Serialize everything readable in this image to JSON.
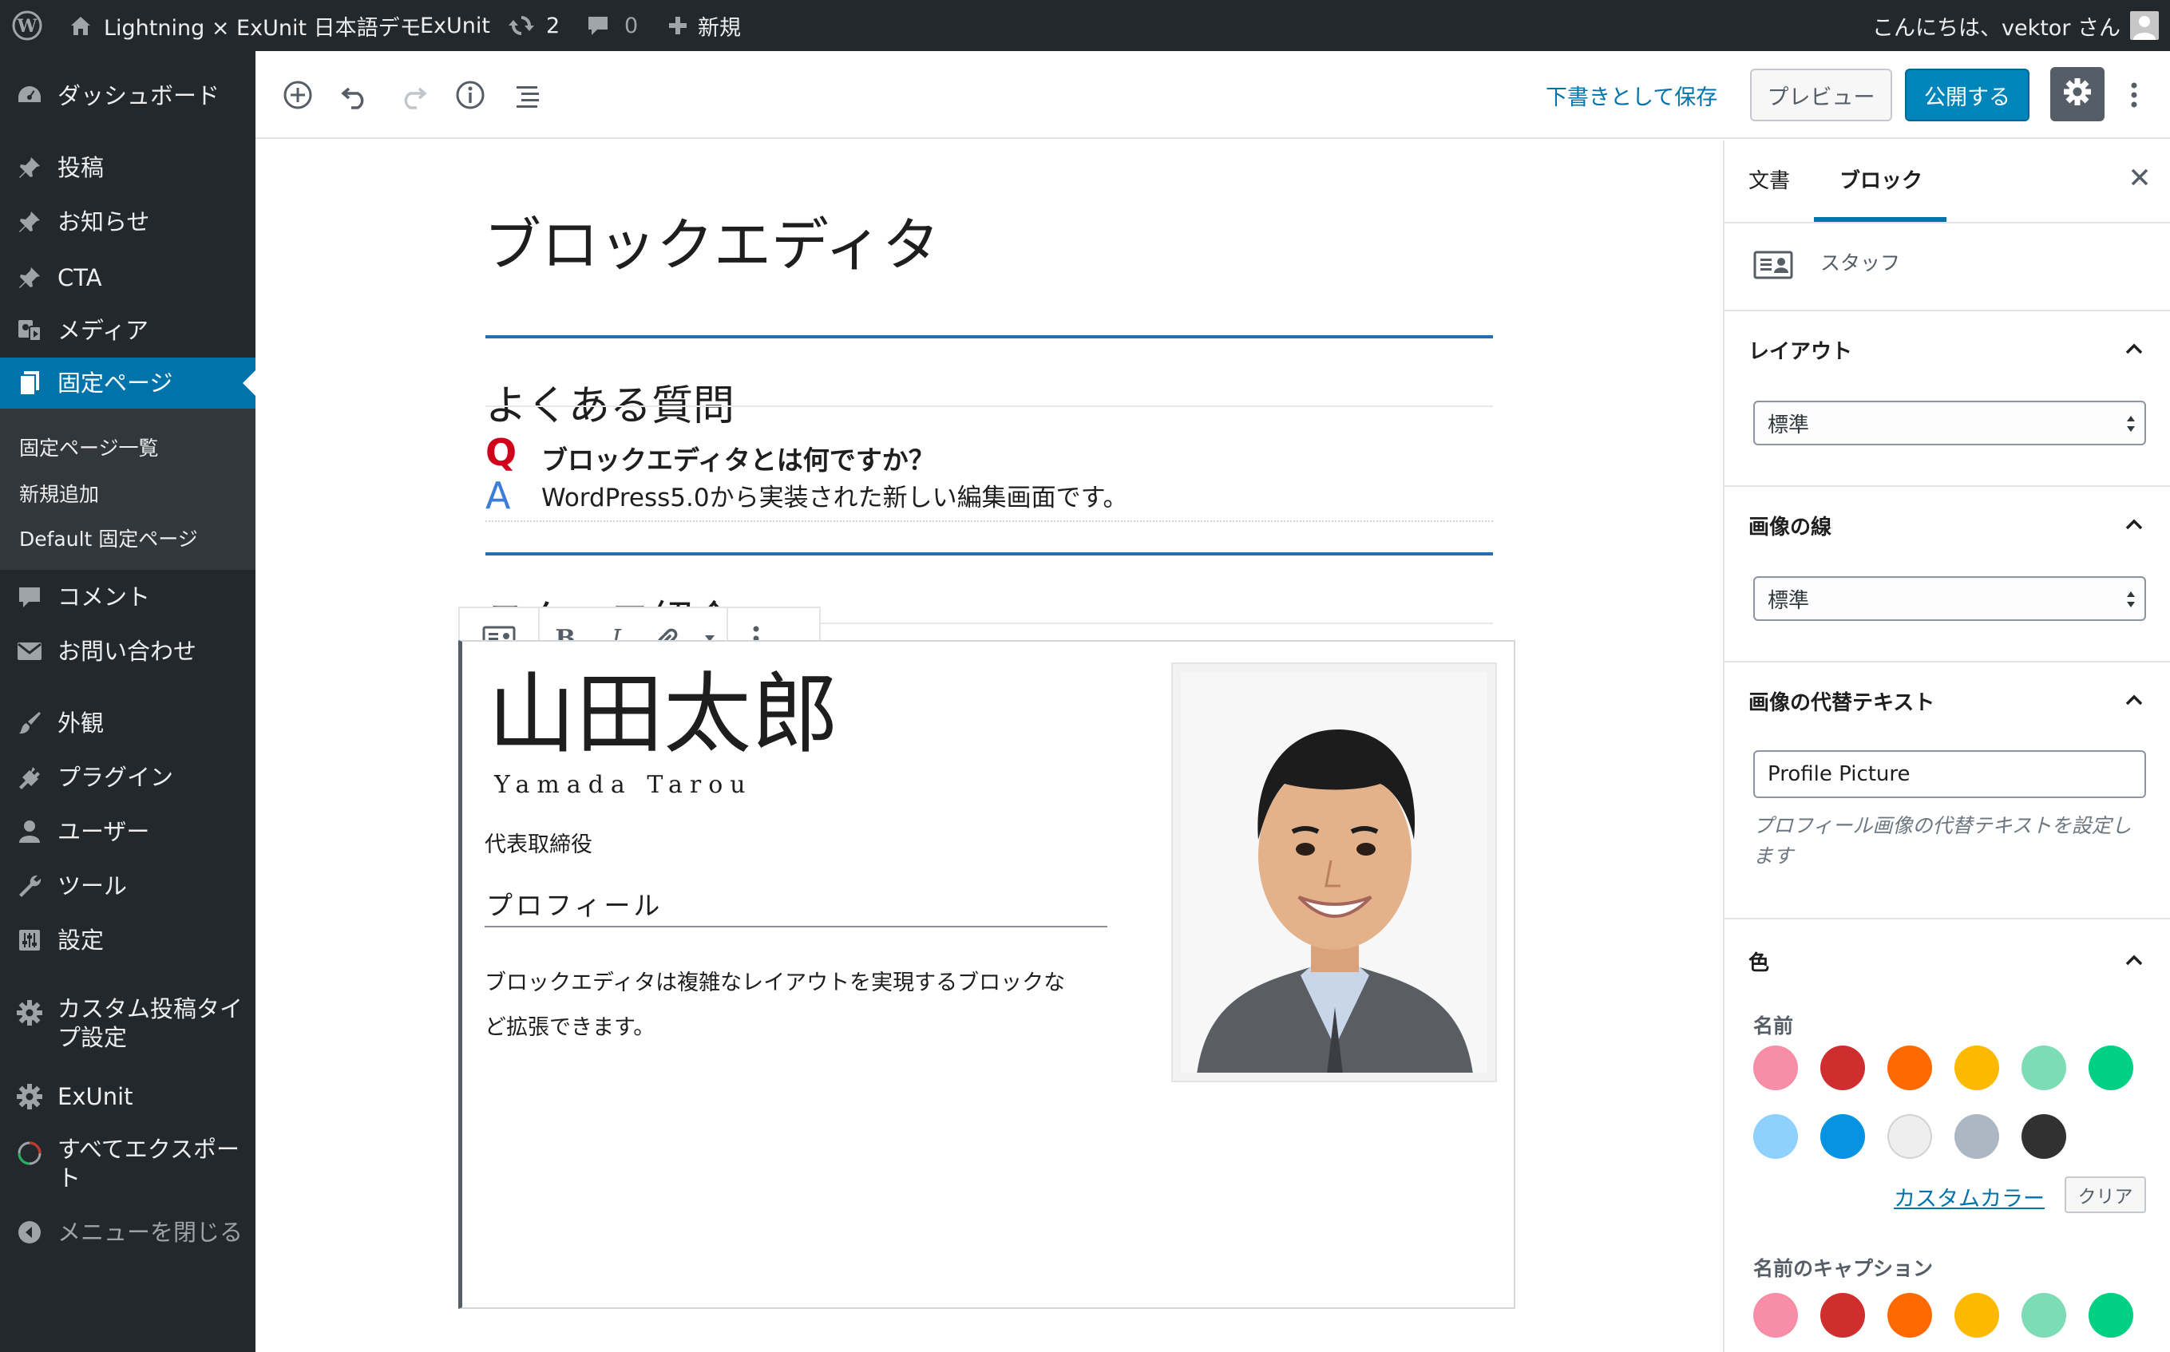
{
  "admin_bar": {
    "site_name": "Lightning × ExUnit 日本語デモ",
    "plugin_menu": "ExUnit",
    "updates_count": "2",
    "comments_count": "0",
    "new_label": "新規",
    "greeting": "こんにちは、vektor さん"
  },
  "menu": {
    "dashboard": "ダッシュボード",
    "posts": "投稿",
    "news": "お知らせ",
    "cta": "CTA",
    "media": "メディア",
    "pages": "固定ページ",
    "pages_sub": [
      "固定ページ一覧",
      "新規追加",
      "Default 固定ページ"
    ],
    "comments": "コメント",
    "contact": "お問い合わせ",
    "appearance": "外観",
    "plugins": "プラグイン",
    "users": "ユーザー",
    "tools": "ツール",
    "settings": "設定",
    "custom_post_type_1": "カスタム投稿タイ",
    "custom_post_type_2": "プ設定",
    "exunit": "ExUnit",
    "export_1": "すべてエクスポー",
    "export_2": "ト",
    "collapse": "メニューを閉じる"
  },
  "toolbar": {
    "save_draft": "下書きとして保存",
    "preview": "プレビュー",
    "publish": "公開する"
  },
  "content": {
    "page_title": "ブロックエディタ",
    "faq_heading": "よくある質問",
    "q_mark": "Q",
    "question": "ブロックエディタとは何ですか？",
    "a_mark": "A",
    "answer": "WordPress5.0から実装された新しい編集画面です。",
    "staff_heading": "スタッフ紹介",
    "staff": {
      "name": "山田太郎",
      "name_en": "Yamada Tarou",
      "role": "代表取締役",
      "profile_heading": "プロフィール",
      "profile_text_1": "ブロックエディタは複雑なレイアウトを実現するブロックな",
      "profile_text_2": "ど拡張できます。"
    }
  },
  "sidebar": {
    "tab_document": "文書",
    "tab_block": "ブロック",
    "block_name": "スタッフ",
    "layout_title": "レイアウト",
    "layout_value": "標準",
    "border_title": "画像の線",
    "border_value": "標準",
    "alt_title": "画像の代替テキスト",
    "alt_value": "Profile Picture",
    "alt_help_1": "プロフィール画像の代替テキストを設定し",
    "alt_help_2": "ます",
    "color_title": "色",
    "name_label": "名前",
    "custom_color": "カスタムカラー",
    "clear": "クリア",
    "caption_label": "名前のキャプション",
    "palette": [
      "#f78da7",
      "#cf2e2e",
      "#ff6900",
      "#fcb900",
      "#7bdcb5",
      "#00d084",
      "#8ed1fc",
      "#0693e3",
      "#eeeeee",
      "#abb8c3",
      "#313131"
    ],
    "palette_row2": [
      "#f78da7",
      "#cf2e2e",
      "#ff6900",
      "#fcb900",
      "#7bdcb5",
      "#00d084"
    ]
  },
  "colors": {
    "admin_dark": "#23282d",
    "admin_blue": "#0073aa",
    "rule_blue": "#1e6fb5",
    "q_red": "#d0021b",
    "a_blue": "#3b7dd8"
  }
}
